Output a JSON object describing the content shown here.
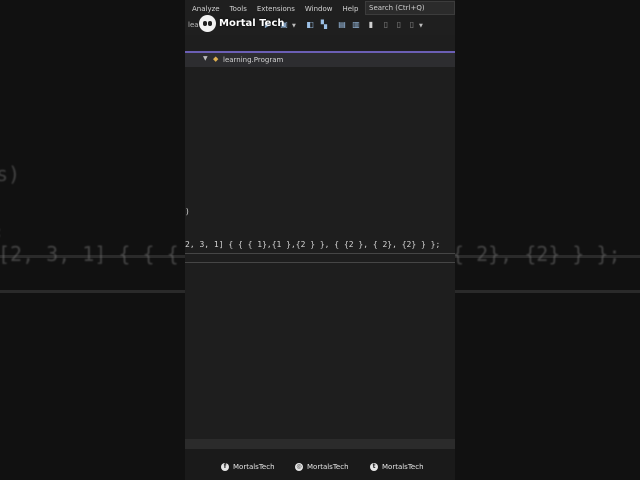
{
  "menu": {
    "items": [
      "Analyze",
      "Tools",
      "Extensions",
      "Window",
      "Help"
    ],
    "search_placeholder": "Search (Ctrl+Q)"
  },
  "toolbar": {
    "prefix_text": "lea",
    "icons": [
      "play-icon",
      "save-icon",
      "layout-icon",
      "step-icon",
      "window-icon",
      "bookmark-icon"
    ]
  },
  "logo": {
    "text": "Mortal Tech"
  },
  "navigation": {
    "class_name": "learning.Program"
  },
  "editor": {
    "fragment_1": ")",
    "code_line": "2, 3, 1] { { { 1},{1 },{2 } }, { {2 }, { 2}, {2} } };"
  },
  "background": {
    "left_text_1": "s)",
    "left_text_2": ":",
    "left_code": "[2, 3, 1] { { {",
    "right_code": "{ 2}, {2} } };"
  },
  "footer": {
    "socials": [
      {
        "platform_icon": "facebook-icon",
        "glyph": "f",
        "handle": "MortalsTech"
      },
      {
        "platform_icon": "instagram-icon",
        "glyph": "◎",
        "handle": "MortalsTech"
      },
      {
        "platform_icon": "twitter-icon",
        "glyph": "t",
        "handle": "MortalsTech"
      }
    ]
  },
  "colors": {
    "accent_line": "#6b5fb5",
    "editor_bg": "#1e1e1e",
    "class_icon": "#e0b050"
  }
}
